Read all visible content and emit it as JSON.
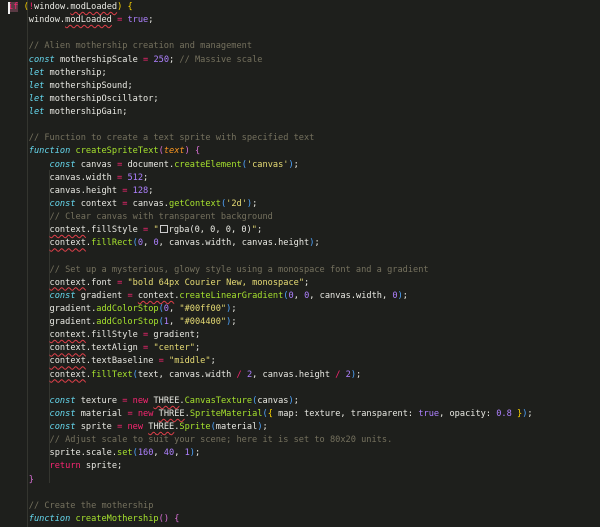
{
  "editor": {
    "language": "javascript",
    "lines": [
      [
        "hl|if",
        "p| ",
        "b1|(",
        "op|!",
        "p|window.",
        "sq|modLoaded",
        "b1|)",
        "p| ",
        "b1|{"
      ],
      [
        "p|    window.",
        "sq|modLoaded",
        "p| ",
        "op|=",
        "p| ",
        "num|true",
        "p|;"
      ],
      [],
      [
        "cm|    // Alien mothership creation and management"
      ],
      [
        "p|    ",
        "kw|const",
        "p| mothershipScale ",
        "op|=",
        "p| ",
        "num|250",
        "p|; ",
        "cm|// Massive scale"
      ],
      [
        "p|    ",
        "kw|let",
        "p| mothership;"
      ],
      [
        "p|    ",
        "kw|let",
        "p| mothershipSound;"
      ],
      [
        "p|    ",
        "kw|let",
        "p| mothershipOscillator;"
      ],
      [
        "p|    ",
        "kw|let",
        "p| mothershipGain;"
      ],
      [],
      [
        "cm|    // Function to create a text sprite with specified text"
      ],
      [
        "p|    ",
        "kw|function",
        "p| ",
        "fn|createSpriteText",
        "b2|(",
        "par|text",
        "b2|)",
        "p| ",
        "b2|{"
      ],
      [
        "p|        ",
        "kw|const",
        "p| canvas ",
        "op|=",
        "p| document.",
        "fn|createElement",
        "b3|(",
        "str|'canvas'",
        "b3|)",
        "p|;"
      ],
      [
        "p|        canvas.width ",
        "op|=",
        "p| ",
        "num|512",
        "p|;"
      ],
      [
        "p|        canvas.height ",
        "op|=",
        "p| ",
        "num|128",
        "p|;"
      ],
      [
        "p|        ",
        "kw|const",
        "p| context ",
        "op|=",
        "p| canvas.",
        "fn|getContext",
        "b3|(",
        "str|'2d'",
        "b3|)",
        "p|;"
      ],
      [
        "cm|        // Clear canvas with transparent background"
      ],
      [
        "p|        ",
        "sq|context",
        "p|.fillStyle ",
        "op|=",
        "p| ",
        "str|\"",
        "sw|",
        "p|rgba(0, 0, 0, 0)",
        "str|\"",
        "p|;"
      ],
      [
        "p|        ",
        "sq|context",
        "p|.",
        "fn|fillRect",
        "b3|(",
        "num|0",
        "p|, ",
        "num|0",
        "p|, canvas.width, canvas.height",
        "b3|)",
        "p|;"
      ],
      [],
      [
        "cm|        // Set up a mysterious, glowy style using a monospace font and a gradient"
      ],
      [
        "p|        ",
        "sq|context",
        "p|.font ",
        "op|=",
        "p| ",
        "str|\"bold 64px Courier New, monospace\"",
        "p|;"
      ],
      [
        "p|        ",
        "kw|const",
        "p| gradient ",
        "op|=",
        "p| ",
        "sq|context",
        "p|.",
        "fn|createLinearGradient",
        "b3|(",
        "num|0",
        "p|, ",
        "num|0",
        "p|, canvas.width, ",
        "num|0",
        "b3|)",
        "p|;"
      ],
      [
        "p|        gradient.",
        "fn|addColorStop",
        "b3|(",
        "num|0",
        "p|, ",
        "str|\"#00ff00\"",
        "b3|)",
        "p|;"
      ],
      [
        "p|        gradient.",
        "fn|addColorStop",
        "b3|(",
        "num|1",
        "p|, ",
        "str|\"#004400\"",
        "b3|)",
        "p|;"
      ],
      [
        "p|        ",
        "sq|context",
        "p|.fillStyle ",
        "op|=",
        "p| gradient;"
      ],
      [
        "p|        ",
        "sq|context",
        "p|.textAlign ",
        "op|=",
        "p| ",
        "str|\"center\"",
        "p|;"
      ],
      [
        "p|        ",
        "sq|context",
        "p|.textBaseline ",
        "op|=",
        "p| ",
        "str|\"middle\"",
        "p|;"
      ],
      [
        "p|        ",
        "sq|context",
        "p|.",
        "fn|fillText",
        "b3|(",
        "p|text, canvas.width ",
        "op|/",
        "p| ",
        "num|2",
        "p|, canvas.height ",
        "op|/",
        "p| ",
        "num|2",
        "b3|)",
        "p|;"
      ],
      [],
      [
        "p|        ",
        "kw|const",
        "p| texture ",
        "op|=",
        "p| ",
        "st|new",
        "p| ",
        "sq|THREE",
        "p|.",
        "fn|CanvasTexture",
        "b3|(",
        "p|canvas",
        "b3|)",
        "p|;"
      ],
      [
        "p|        ",
        "kw|const",
        "p| material ",
        "op|=",
        "p| ",
        "st|new",
        "p| ",
        "sq|THREE",
        "p|.",
        "fn|SpriteMaterial",
        "b3|(",
        "b1|{",
        "p| map: texture, transparent: ",
        "num|true",
        "p|, opacity: ",
        "num|0.8",
        "p| ",
        "b1|}",
        "b3|)",
        "p|;"
      ],
      [
        "p|        ",
        "kw|const",
        "p| sprite ",
        "op|=",
        "p| ",
        "st|new",
        "p| ",
        "sq|THREE",
        "p|.",
        "fn|Sprite",
        "b3|(",
        "p|material",
        "b3|)",
        "p|;"
      ],
      [
        "cm|        // Adjust scale to suit your scene; here it is set to 80x20 units."
      ],
      [
        "p|        sprite.scale.",
        "fn|set",
        "b3|(",
        "num|160",
        "p|, ",
        "num|40",
        "p|, ",
        "num|1",
        "b3|)",
        "p|;"
      ],
      [
        "p|        ",
        "st|return",
        "p| sprite;"
      ],
      [
        "p|    ",
        "b2|}"
      ],
      [],
      [
        "cm|    // Create the mothership"
      ],
      [
        "p|    ",
        "kw|function",
        "p| ",
        "fn|createMothership",
        "b2|(",
        "b2|)",
        "p| ",
        "b2|{"
      ]
    ]
  }
}
